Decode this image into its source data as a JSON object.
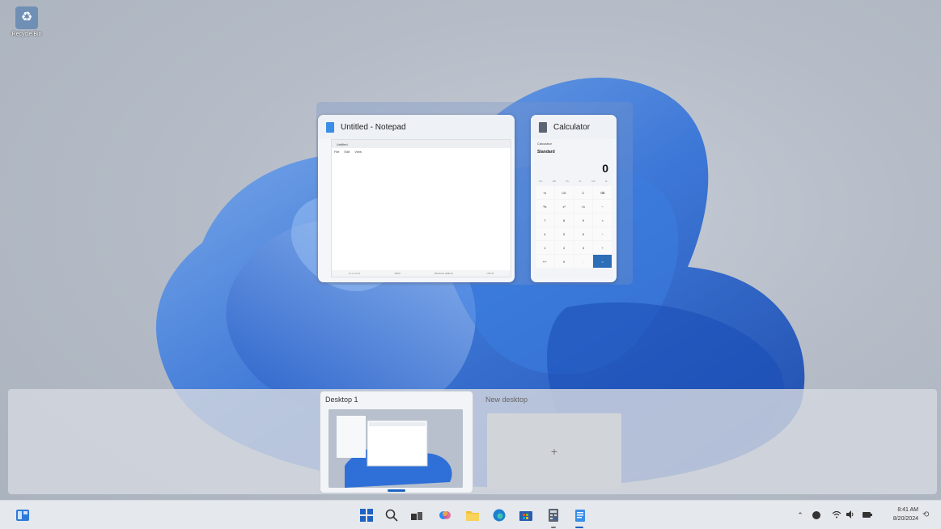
{
  "desktop": {
    "icons": [
      {
        "label": "Recycle Bin",
        "icon": "recycle-bin-icon"
      }
    ]
  },
  "task_view": {
    "windows": [
      {
        "app": "notepad",
        "title": "Untitled - Notepad",
        "icon": "notepad-icon",
        "tab_label": "Untitled",
        "menu": [
          "File",
          "Edit",
          "View"
        ],
        "status": [
          "Ln 1, Col 1",
          "100%",
          "Windows (CRLF)",
          "UTF-8"
        ]
      },
      {
        "app": "calculator",
        "title": "Calculator",
        "icon": "calculator-icon",
        "top_label": "Calculator",
        "mode": "Standard",
        "display": "0",
        "memory": [
          "MC",
          "MR",
          "M+",
          "M-",
          "MS",
          "M~"
        ],
        "keys": [
          "%",
          "CE",
          "C",
          "⌫",
          "⅟x",
          "x²",
          "√x",
          "÷",
          "7",
          "8",
          "9",
          "×",
          "4",
          "5",
          "6",
          "−",
          "1",
          "2",
          "3",
          "+",
          "+/−",
          "0",
          ".",
          "="
        ]
      }
    ]
  },
  "desktops": {
    "items": [
      {
        "label": "Desktop 1",
        "active": true
      }
    ],
    "new_label": "New desktop",
    "new_symbol": "+"
  },
  "taskbar": {
    "left": [
      {
        "icon": "widgets-icon"
      }
    ],
    "center": [
      {
        "icon": "start-icon"
      },
      {
        "icon": "search-icon"
      },
      {
        "icon": "task-view-icon"
      },
      {
        "icon": "copilot-icon"
      },
      {
        "icon": "file-explorer-icon"
      },
      {
        "icon": "edge-icon"
      },
      {
        "icon": "store-icon"
      },
      {
        "icon": "calculator-icon",
        "running": true
      },
      {
        "icon": "notepad-icon",
        "running": true
      }
    ],
    "tray": [
      {
        "icon": "chevron-up-icon"
      },
      {
        "icon": "onedrive-icon"
      },
      {
        "icon": "wifi-icon"
      },
      {
        "icon": "volume-icon"
      },
      {
        "icon": "battery-icon"
      }
    ],
    "time": "8:41 AM",
    "date": "8/20/2024",
    "colors": {
      "accent": "#1f63c2",
      "taskbar_bg": "#e5e8ed"
    }
  }
}
